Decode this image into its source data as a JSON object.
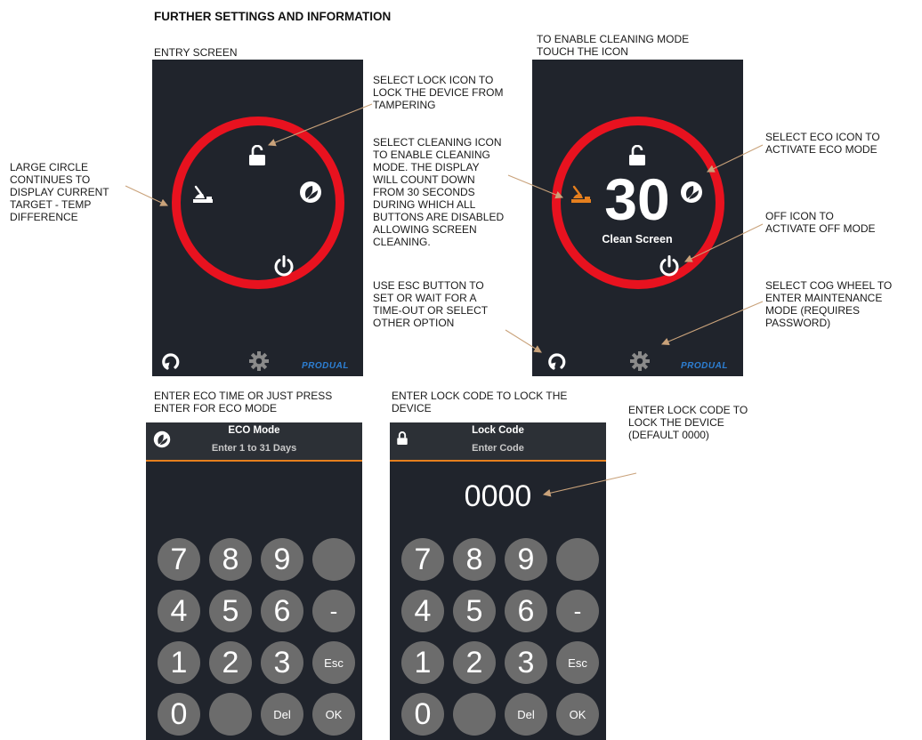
{
  "page_title": "FURTHER SETTINGS AND INFORMATION",
  "labels": {
    "entry_screen": "ENTRY SCREEN",
    "cleaning_mode": [
      "TO ENABLE CLEANING MODE",
      "TOUCH THE ICON"
    ],
    "lock_icon": [
      "SELECT LOCK ICON TO",
      "LOCK THE DEVICE FROM",
      "TAMPERING"
    ],
    "large_circle": [
      "LARGE CIRCLE",
      "CONTINUES TO",
      "DISPLAY CURRENT",
      "TARGET - TEMP",
      "DIFFERENCE"
    ],
    "cleaning_icon": [
      "SELECT CLEANING ICON",
      "TO ENABLE CLEANING",
      "MODE. THE DISPLAY",
      "WILL COUNT DOWN",
      "FROM 30 SECONDS",
      "DURING WHICH ALL",
      "BUTTONS ARE DISABLED",
      "ALLOWING SCREEN",
      "CLEANING."
    ],
    "esc_button": [
      "USE ESC BUTTON TO",
      "SET  OR WAIT FOR A",
      "TIME-OUT OR SELECT",
      "OTHER OPTION"
    ],
    "eco_icon": [
      "SELECT ECO ICON TO",
      "ACTIVATE ECO MODE"
    ],
    "off_icon": [
      "OFF ICON TO",
      "ACTIVATE OFF MODE"
    ],
    "cog_wheel": [
      "SELECT COG WHEEL TO",
      "ENTER MAINTENANCE",
      "MODE (REQUIRES",
      "PASSWORD)"
    ],
    "eco_time": [
      "ENTER ECO TIME OR JUST PRESS",
      "ENTER FOR ECO MODE"
    ],
    "lock_code_top": [
      "ENTER LOCK CODE TO LOCK THE",
      "DEVICE"
    ],
    "lock_code_right": [
      "ENTER LOCK CODE TO",
      "LOCK THE DEVICE",
      "(DEFAULT 0000)"
    ]
  },
  "entry_screen": {
    "brand": "PRODUAL"
  },
  "cleaning_screen": {
    "countdown": "30",
    "caption": "Clean Screen",
    "brand": "PRODUAL"
  },
  "eco_keypad": {
    "title": "ECO Mode",
    "subtitle": "Enter 1 to 31 Days",
    "display": "",
    "keys": [
      "7",
      "8",
      "9",
      "",
      "4",
      "5",
      "6",
      "-",
      "1",
      "2",
      "3",
      "Esc",
      "0",
      "",
      "Del",
      "OK"
    ]
  },
  "lock_keypad": {
    "title": "Lock Code",
    "subtitle": "Enter Code",
    "display": "0000",
    "keys": [
      "7",
      "8",
      "9",
      "",
      "4",
      "5",
      "6",
      "-",
      "1",
      "2",
      "3",
      "Esc",
      "0",
      "",
      "Del",
      "OK"
    ]
  },
  "colors": {
    "ring": "#e8121f",
    "screen_bg": "#20242c",
    "accent": "#e57f1e",
    "key": "#6c6c6c",
    "arrow": "#c9a27a",
    "brand": "#2d7fd3"
  },
  "icons": [
    "lock-icon",
    "cleaning-icon",
    "eco-leaf-icon",
    "power-icon",
    "back-icon",
    "gear-icon"
  ]
}
